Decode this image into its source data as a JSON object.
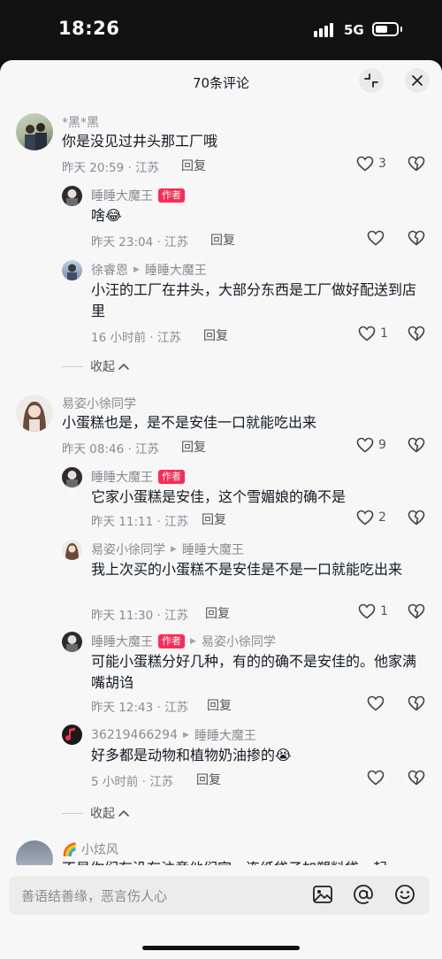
{
  "status_bar": {
    "time": "18:26",
    "network": "5G"
  },
  "sheet": {
    "title": "70条评论"
  },
  "comments": [
    {
      "user": "*黑*黑",
      "text": "你是没见过井头那工厂哦",
      "meta": "昨天 20:59 · 江苏",
      "reply": "回复",
      "likes": "3"
    },
    {
      "user": "睡睡大魔王",
      "badge": "作者",
      "text": "啥😂",
      "meta": "昨天 23:04 · 江苏",
      "reply": "回复",
      "likes": ""
    },
    {
      "user": "徐睿恩",
      "to": "睡睡大魔王",
      "text": "小汪的工厂在井头，大部分东西是工厂做好配送到店里",
      "meta": "16 小时前 · 江苏",
      "reply": "回复",
      "likes": "1"
    },
    {
      "collapse": "收起"
    },
    {
      "user": "易姿小徐同学",
      "text": "小蛋糕也是，是不是安佳一口就能吃出来",
      "meta": "昨天 08:46 · 江苏",
      "reply": "回复",
      "likes": "9"
    },
    {
      "user": "睡睡大魔王",
      "badge": "作者",
      "text": "它家小蛋糕是安佳，这个雪媚娘的确不是",
      "meta": "昨天 11:11 · 江苏",
      "reply": "回复",
      "likes": "2"
    },
    {
      "user": "易姿小徐同学",
      "to": "睡睡大魔王",
      "text": "我上次买的小蛋糕不是安佳是不是一口就能吃出来",
      "meta": "昨天 11:30 · 江苏",
      "reply": "回复",
      "likes": "1"
    },
    {
      "user": "睡睡大魔王",
      "badge": "作者",
      "to": "易姿小徐同学",
      "text": "可能小蛋糕分好几种，有的的确不是安佳的。他家满嘴胡诌",
      "meta": "昨天 12:43 · 江苏",
      "reply": "回复",
      "likes": ""
    },
    {
      "user": "36219466294",
      "to": "睡睡大魔王",
      "text": "好多都是动物和植物奶油掺的😭",
      "meta": "5 小时前 · 江苏",
      "reply": "回复",
      "likes": ""
    },
    {
      "collapse": "收起"
    },
    {
      "user": "🌈 小炫风",
      "text": "不是你们有没有注意他们家，连纸袋子加塑料袋一起"
    }
  ],
  "input": {
    "placeholder": "善语结善缘，恶言伤人心"
  },
  "icons": {
    "shrink": "shrink-icon",
    "close": "close-icon",
    "heart": "heart-icon",
    "dislike": "broken-heart-icon",
    "image": "image-icon",
    "mention": "at-icon",
    "emoji": "emoji-icon"
  },
  "colors": {
    "accent": "#fe2c55",
    "sheet_bg": "#f7f7f7",
    "status_bg": "#121212"
  }
}
